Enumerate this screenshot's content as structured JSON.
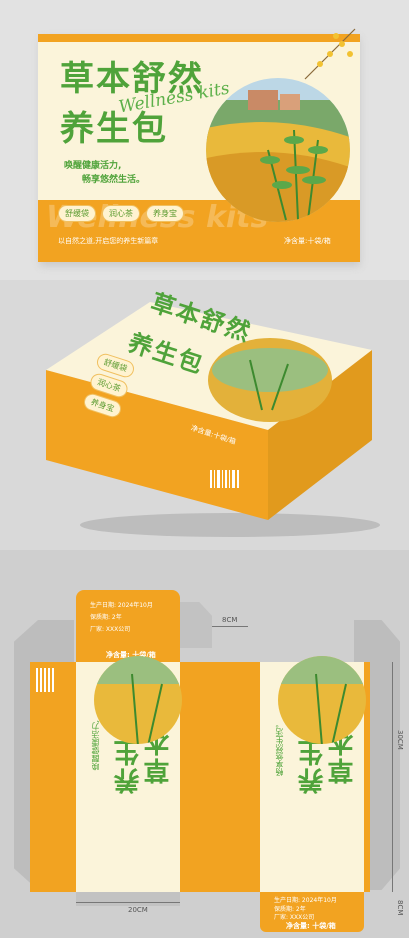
{
  "front": {
    "title_line1": "草本舒然",
    "title_line2": "养生包",
    "script": "Wellness kits",
    "slogan1": "唤醒健康活力,",
    "slogan2": "畅享悠然生活。",
    "tags": [
      "舒缓袋",
      "润心茶",
      "养身宝"
    ],
    "bottom_left": "以自然之道,开启您的养生新篇章",
    "bottom_right": "净含量:十袋/箱",
    "bg_watermark": "Wellness kits"
  },
  "dieline": {
    "production_date": "生产日期: 2024年10月",
    "shelf_life": "保质期: 2年",
    "manufacturer": "厂家: XXX公司",
    "net_content": "净含量: 十袋/箱",
    "dim_8cm_top": "8CM",
    "dim_30cm": "30CM",
    "dim_20cm": "20CM",
    "dim_8cm_right": "8CM"
  },
  "colors": {
    "orange": "#f2a321",
    "cream": "#fbf4da",
    "green": "#4fa33a"
  }
}
